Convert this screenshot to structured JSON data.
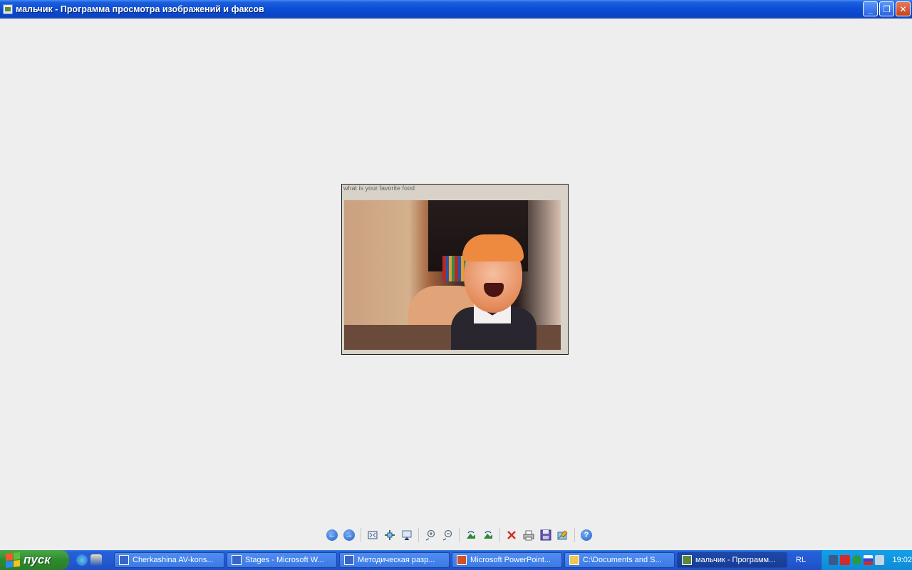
{
  "window": {
    "title": "мальчик - Программа просмотра изображений и факсов",
    "controls": {
      "minimize": "_",
      "restore": "❐",
      "close": "✕"
    }
  },
  "photo": {
    "caption": "what is your favorite food"
  },
  "toolbar": {
    "buttons": [
      {
        "name": "previous-image",
        "icon": "arrow-left-icon"
      },
      {
        "name": "next-image",
        "icon": "arrow-right-icon"
      },
      {
        "name": "best-fit",
        "icon": "best-fit-icon"
      },
      {
        "name": "actual-size",
        "icon": "actual-size-icon"
      },
      {
        "name": "slideshow",
        "icon": "slideshow-icon"
      },
      {
        "name": "zoom-in",
        "icon": "zoom-in-icon"
      },
      {
        "name": "zoom-out",
        "icon": "zoom-out-icon"
      },
      {
        "name": "rotate-clockwise",
        "icon": "rotate-clockwise-icon"
      },
      {
        "name": "rotate-counterclockwise",
        "icon": "rotate-counterclockwise-icon"
      },
      {
        "name": "delete",
        "icon": "delete-icon"
      },
      {
        "name": "print",
        "icon": "print-icon"
      },
      {
        "name": "save",
        "icon": "save-icon"
      },
      {
        "name": "edit",
        "icon": "edit-icon"
      },
      {
        "name": "help",
        "icon": "help-icon"
      }
    ]
  },
  "taskbar": {
    "start_label": "пуск",
    "tasks": [
      {
        "label": "Cherkashina AV-kons...",
        "icon": "word-icon",
        "active": false
      },
      {
        "label": "Stages - Microsoft W...",
        "icon": "word-icon",
        "active": false
      },
      {
        "label": "Методическая разр...",
        "icon": "word-icon",
        "active": false
      },
      {
        "label": "Microsoft PowerPoint...",
        "icon": "powerpoint-icon",
        "active": false
      },
      {
        "label": "C:\\Documents and S...",
        "icon": "folder-icon",
        "active": false
      },
      {
        "label": "мальчик - Программ...",
        "icon": "image-viewer-icon",
        "active": true
      }
    ],
    "language": "RL",
    "clock": "19:02"
  },
  "colors": {
    "titlebar": "#0a4fd8",
    "viewer_bg": "#eeeeee",
    "taskbar": "#245ad4",
    "start": "#2e8a2e",
    "tray": "#0f8ad6"
  }
}
